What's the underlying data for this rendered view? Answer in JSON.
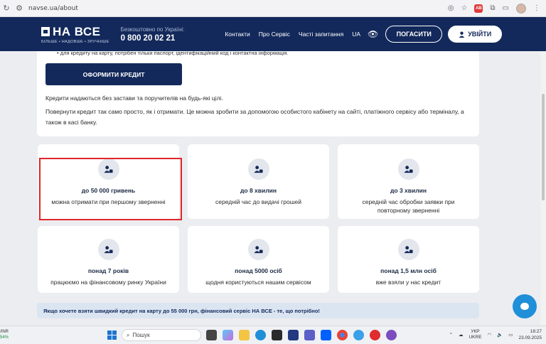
{
  "browser": {
    "url": "navse.ua/about"
  },
  "header": {
    "logo_text": "НА ВСЕ",
    "logo_tagline": "БІЛЬШЕ • НАДОВШЕ • ЗРУЧНІШЕ",
    "phone_label": "Безкоштовно по Україні:",
    "phone_number": "0 800 20 02 21",
    "nav": [
      "Контакти",
      "Про Сервіс",
      "Часті запитання",
      "UA"
    ],
    "pay_button": "ПОГАСИТИ",
    "login_button": "УВІЙТИ"
  },
  "content": {
    "bullet_partial": "для кредиту на карту, потрібен тільки паспорт, ідентифікаційний код і контактна інформація.",
    "order_button": "ОФОРМИТИ КРЕДИТ",
    "para1": "Кредити надаються без застави та поручителів на будь-які цілі.",
    "para2_line1": "Повернути кредит так само просто, як і отримати. Це можна зробити за допомогою особистого кабінету на сайті, платіжного сервісу або терміналу, а",
    "para2_line2": "також в касі банку."
  },
  "stats": [
    {
      "title": "до 50 000 гривень",
      "desc": "можна отримати при першому зверненні"
    },
    {
      "title": "до 8 хвилин",
      "desc": "середній час до видачі грошей"
    },
    {
      "title": "до 3 хвилин",
      "desc": "середній час обробки заявки при повторному зверненні"
    },
    {
      "title": "понад 7 років",
      "desc": "працюємо на фінансовому ринку України"
    },
    {
      "title": "понад 5000 осіб",
      "desc": "щодня користуються нашим сервісом"
    },
    {
      "title": "понад 1,5 млн осіб",
      "desc": "вже взяли у нас кредит"
    }
  ],
  "banner": "Якщо хочете взяти швидкий кредит на карту до 55 000 грн, фінансовий сервіс НА ВСЕ - те, що потрібно!",
  "taskbar": {
    "ticker_label": "/INR",
    "ticker_value": "54%",
    "search_placeholder": "Пошук",
    "lang_top": "УКР",
    "lang_bottom": "UKRE",
    "time": "18:27",
    "date": "23.09.2025"
  },
  "colors": {
    "brand_navy": "#13295b",
    "highlight_red": "#e0262b",
    "chat_blue": "#1e8fd8"
  }
}
